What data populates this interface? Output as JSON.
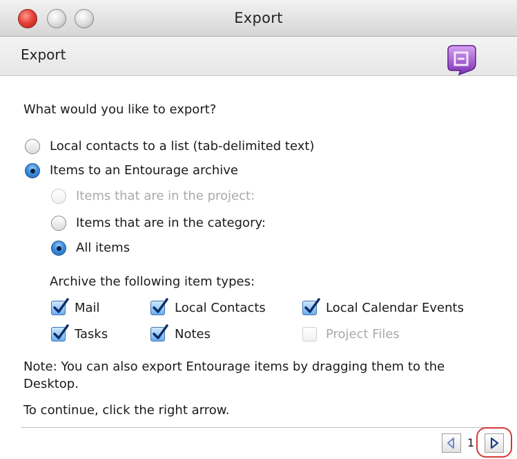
{
  "window": {
    "title": "Export"
  },
  "header": {
    "title": "Export"
  },
  "question": "What would you like to export?",
  "export_options": [
    {
      "label": "Local contacts to a list (tab-delimited text)",
      "selected": false
    },
    {
      "label": "Items to an Entourage archive",
      "selected": true
    }
  ],
  "archive_scope": [
    {
      "label": "Items that are in the project:",
      "selected": false,
      "enabled": false
    },
    {
      "label": "Items that are in the category:",
      "selected": false,
      "enabled": true
    },
    {
      "label": "All items",
      "selected": true,
      "enabled": true
    }
  ],
  "item_types_label": "Archive the following item types:",
  "item_types": [
    {
      "label": "Mail",
      "checked": true,
      "enabled": true
    },
    {
      "label": "Local Contacts",
      "checked": true,
      "enabled": true
    },
    {
      "label": "Local Calendar Events",
      "checked": true,
      "enabled": true
    },
    {
      "label": "Tasks",
      "checked": true,
      "enabled": true
    },
    {
      "label": "Notes",
      "checked": true,
      "enabled": true
    },
    {
      "label": "Project Files",
      "checked": false,
      "enabled": false
    }
  ],
  "note": {
    "line1": "Note: You can also export Entourage items by dragging them to the",
    "line2": "Desktop."
  },
  "instruction": "To continue, click the right arrow.",
  "navigation": {
    "page": "1"
  },
  "colors": {
    "accent": "#2f6fd0",
    "highlight": "#d23a36",
    "logo": "#8b3fbf"
  },
  "icons": {
    "logo": "entourage-logo-icon",
    "prev": "arrow-left-icon",
    "next": "arrow-right-icon"
  }
}
